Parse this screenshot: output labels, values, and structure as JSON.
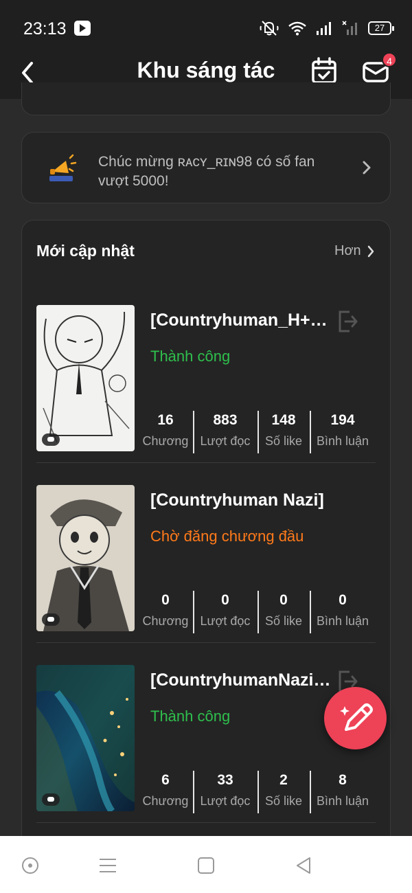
{
  "status_bar": {
    "time": "23:13",
    "battery": "27",
    "icons": [
      "app-notification-icon",
      "mute-icon",
      "wifi-icon",
      "signal-icon",
      "signal-x-icon",
      "battery-icon"
    ]
  },
  "header": {
    "title": "Khu sáng tác",
    "back_icon": "chevron-left-icon",
    "calendar_icon": "calendar-check-icon",
    "mail_icon": "mail-icon",
    "mail_badge": "4"
  },
  "announcement": {
    "text": "Chúc mừng ʀᴀᴄʏ_ʀɪɴ98 có số fan vượt 5000!",
    "icon": "megaphone-icon",
    "accent": "#f5a623"
  },
  "updates": {
    "title": "Mới cập nhật",
    "more_label": "Hơn",
    "stat_labels": [
      "Chương",
      "Lượt đọc",
      "Số like",
      "Bình luận"
    ],
    "items": [
      {
        "title": "[Countryhuman_H+_...",
        "status": "Thành công",
        "status_color": "#2fbf4d",
        "stats": [
          "16",
          "883",
          "148",
          "194"
        ]
      },
      {
        "title": "[Countryhuman Nazi]",
        "status": "Chờ đăng chương đầu",
        "status_color": "#ff7a1a",
        "stats": [
          "0",
          "0",
          "0",
          "0"
        ]
      },
      {
        "title": "[CountryhumanNazix...",
        "status": "Thành công",
        "status_color": "#2fbf4d",
        "stats": [
          "6",
          "33",
          "2",
          "8"
        ]
      }
    ]
  },
  "fab": {
    "icon": "pencil-sparkle-icon",
    "color": "#ee4257"
  },
  "nav_bar": {
    "icons": [
      "home-circle-icon",
      "menu-icon",
      "square-icon",
      "back-triangle-icon"
    ]
  }
}
